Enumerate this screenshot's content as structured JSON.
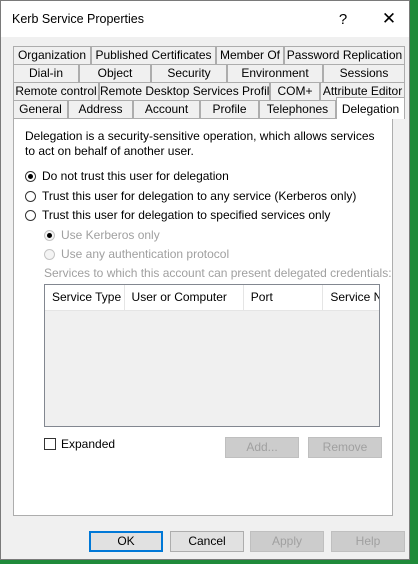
{
  "window": {
    "title": "Kerb Service Properties",
    "help_glyph": "?",
    "close_glyph": "✕"
  },
  "tabs": {
    "row1": [
      "Organization",
      "Published Certificates",
      "Member Of",
      "Password Replication"
    ],
    "row2": [
      "Dial-in",
      "Object",
      "Security",
      "Environment",
      "Sessions"
    ],
    "row3": [
      "Remote control",
      "Remote Desktop Services Profile",
      "COM+",
      "Attribute Editor"
    ],
    "row4": [
      "General",
      "Address",
      "Account",
      "Profile",
      "Telephones",
      "Delegation"
    ],
    "active": "Delegation"
  },
  "delegation": {
    "description": "Delegation is a security-sensitive operation, which allows services to act on behalf of another user.",
    "options": [
      {
        "label": "Do not trust this user for delegation",
        "checked": true
      },
      {
        "label": "Trust this user for delegation to any service (Kerberos only)",
        "checked": false
      },
      {
        "label": "Trust this user for delegation to specified services only",
        "checked": false
      }
    ],
    "sub_options": [
      {
        "label": "Use Kerberos only",
        "checked": true,
        "disabled": true
      },
      {
        "label": "Use any authentication protocol",
        "checked": false,
        "disabled": true
      }
    ],
    "services_label": "Services to which this account can present delegated credentials:",
    "columns": [
      "Service Type",
      "User or Computer",
      "Port",
      "Service Na"
    ],
    "expanded_label": "Expanded",
    "add_label": "Add...",
    "remove_label": "Remove"
  },
  "footer": {
    "ok": "OK",
    "cancel": "Cancel",
    "apply": "Apply",
    "help": "Help"
  }
}
